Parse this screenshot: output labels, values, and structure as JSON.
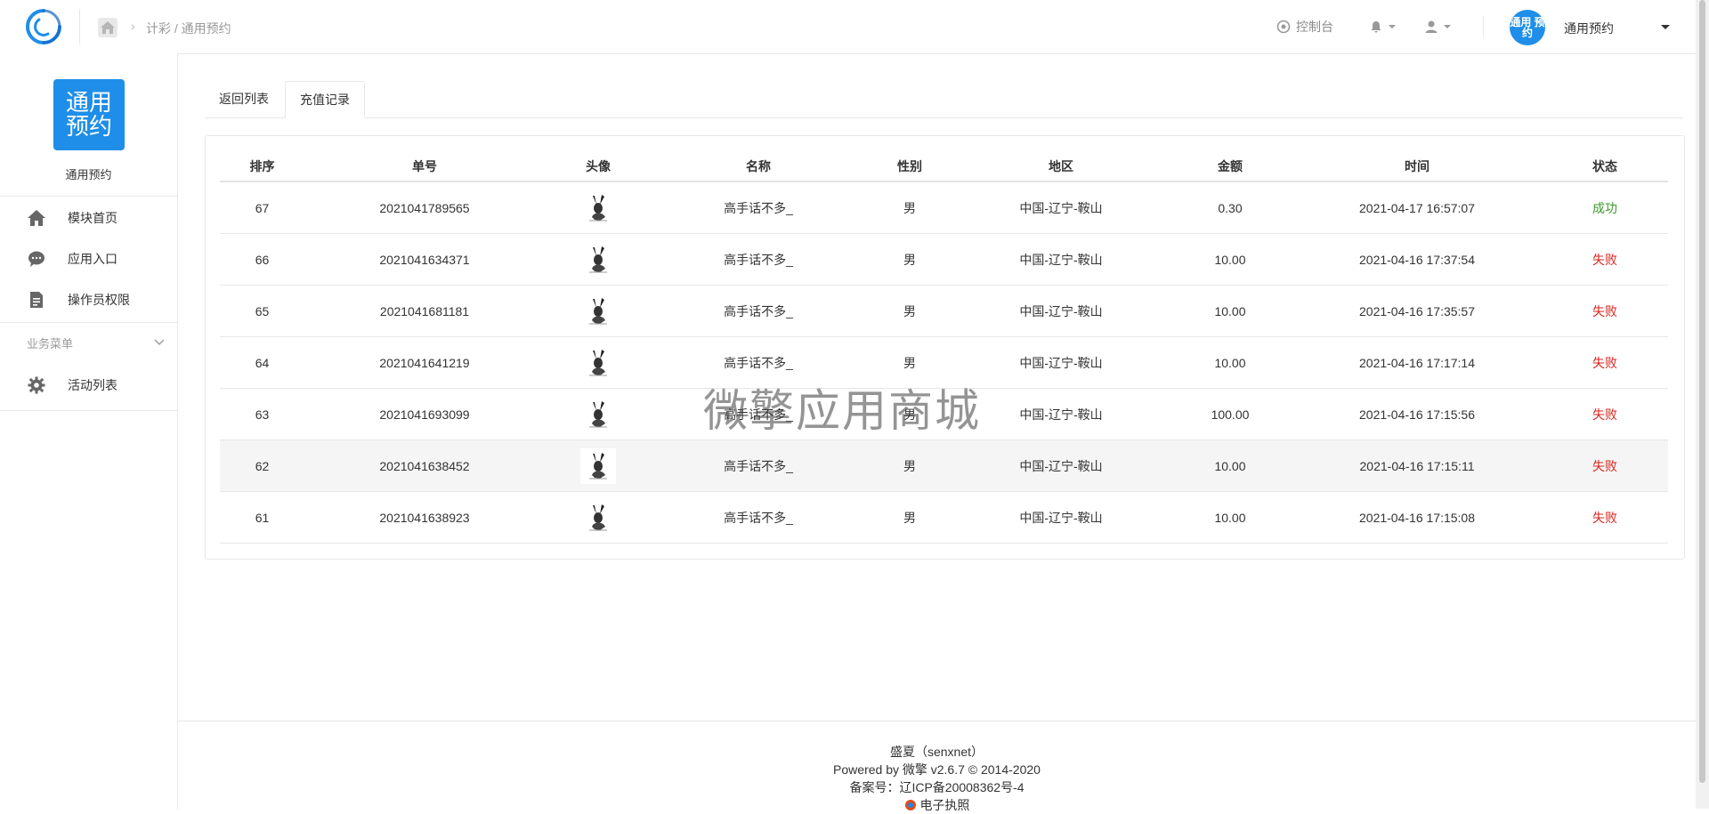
{
  "topbar": {
    "breadcrumb": "计彩 / 通用预约",
    "console_label": "控制台",
    "app_avatar_text": "通用 预约",
    "app_name": "通用预约"
  },
  "sidebar": {
    "logo_text": "通用 预约",
    "app_name": "通用预约",
    "items": [
      {
        "label": "模块首页",
        "icon": "home-icon"
      },
      {
        "label": "应用入口",
        "icon": "chat-icon"
      },
      {
        "label": "操作员权限",
        "icon": "document-icon"
      }
    ],
    "group_label": "业务菜单",
    "group_items": [
      {
        "label": "活动列表",
        "icon": "gear-icon"
      }
    ]
  },
  "tabs": [
    {
      "label": "返回列表",
      "active": false
    },
    {
      "label": "充值记录",
      "active": true
    }
  ],
  "table": {
    "headers": [
      "排序",
      "单号",
      "头像",
      "名称",
      "性别",
      "地区",
      "金额",
      "时间",
      "状态"
    ],
    "rows": [
      {
        "rank": "67",
        "order": "2021041789565",
        "name": "高手话不多_",
        "gender": "男",
        "region": "中国-辽宁-鞍山",
        "amount": "0.30",
        "time": "2021-04-17 16:57:07",
        "status": "成功"
      },
      {
        "rank": "66",
        "order": "2021041634371",
        "name": "高手话不多_",
        "gender": "男",
        "region": "中国-辽宁-鞍山",
        "amount": "10.00",
        "time": "2021-04-16 17:37:54",
        "status": "失败"
      },
      {
        "rank": "65",
        "order": "2021041681181",
        "name": "高手话不多_",
        "gender": "男",
        "region": "中国-辽宁-鞍山",
        "amount": "10.00",
        "time": "2021-04-16 17:35:57",
        "status": "失败"
      },
      {
        "rank": "64",
        "order": "2021041641219",
        "name": "高手话不多_",
        "gender": "男",
        "region": "中国-辽宁-鞍山",
        "amount": "10.00",
        "time": "2021-04-16 17:17:14",
        "status": "失败"
      },
      {
        "rank": "63",
        "order": "2021041693099",
        "name": "高手话不多_",
        "gender": "男",
        "region": "中国-辽宁-鞍山",
        "amount": "100.00",
        "time": "2021-04-16 17:15:56",
        "status": "失败"
      },
      {
        "rank": "62",
        "order": "2021041638452",
        "name": "高手话不多_",
        "gender": "男",
        "region": "中国-辽宁-鞍山",
        "amount": "10.00",
        "time": "2021-04-16 17:15:11",
        "status": "失败"
      },
      {
        "rank": "61",
        "order": "2021041638923",
        "name": "高手话不多_",
        "gender": "男",
        "region": "中国-辽宁-鞍山",
        "amount": "10.00",
        "time": "2021-04-16 17:15:08",
        "status": "失败"
      }
    ]
  },
  "watermark": "微擎应用商城",
  "footer": {
    "line1": "盛夏（senxnet）",
    "line2": "Powered by 微擎 v2.6.7 © 2014-2020",
    "line3": "备案号：辽ICP备20008362号-4",
    "line4": "电子执照"
  },
  "colors": {
    "brand": "#1f8ee8",
    "success": "#3c9a2d",
    "fail": "#d9251c"
  }
}
